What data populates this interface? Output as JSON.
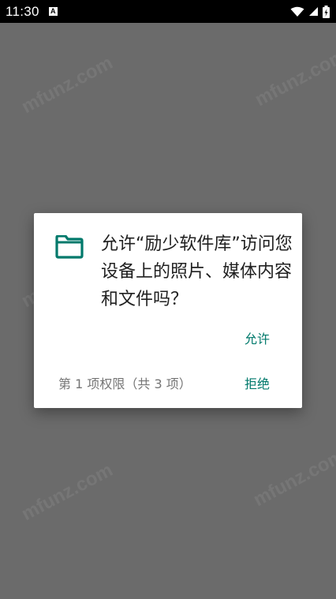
{
  "status_bar": {
    "time": "11:30",
    "notification_glyph": "A",
    "icons": [
      "wifi-icon",
      "signal-icon",
      "battery-icon"
    ]
  },
  "watermark": {
    "text": "mfunz.com"
  },
  "dialog": {
    "icon": "folder-icon",
    "title": "允许“励少软件库”访问您设备上的照片、媒体内容和文件吗？",
    "allow_label": "允许",
    "deny_label": "拒绝",
    "counter_text": "第 1 项权限（共 3 项）"
  },
  "colors": {
    "accent": "#00796b",
    "scrim": "#6b6b6b",
    "status_bar": "#000000",
    "dialog_bg": "#ffffff",
    "title_text": "#202020",
    "secondary_text": "#757575"
  }
}
